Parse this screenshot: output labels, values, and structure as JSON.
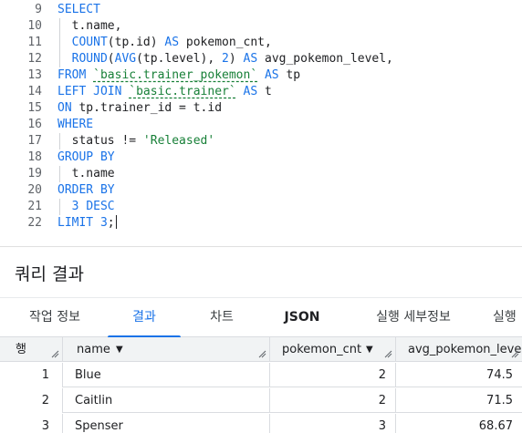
{
  "editor": {
    "lines": [
      {
        "n": "9",
        "tokens": [
          {
            "t": "SELECT",
            "c": "kw"
          }
        ]
      },
      {
        "n": "10",
        "tokens": [
          {
            "t": "  t.name,",
            "c": "plain"
          }
        ]
      },
      {
        "n": "11",
        "tokens": [
          {
            "t": "  ",
            "c": "plain"
          },
          {
            "t": "COUNT",
            "c": "fn"
          },
          {
            "t": "(tp.id) ",
            "c": "plain"
          },
          {
            "t": "AS",
            "c": "kw"
          },
          {
            "t": " pokemon_cnt,",
            "c": "plain"
          }
        ]
      },
      {
        "n": "12",
        "tokens": [
          {
            "t": "  ",
            "c": "plain"
          },
          {
            "t": "ROUND",
            "c": "fn"
          },
          {
            "t": "(",
            "c": "plain"
          },
          {
            "t": "AVG",
            "c": "fn"
          },
          {
            "t": "(tp.level), ",
            "c": "plain"
          },
          {
            "t": "2",
            "c": "num"
          },
          {
            "t": ") ",
            "c": "plain"
          },
          {
            "t": "AS",
            "c": "kw"
          },
          {
            "t": " avg_pokemon_level,",
            "c": "plain"
          }
        ]
      },
      {
        "n": "13",
        "tokens": [
          {
            "t": "FROM",
            "c": "kw"
          },
          {
            "t": " ",
            "c": "plain"
          },
          {
            "t": "`basic.trainer_pokemon`",
            "c": "tbl"
          },
          {
            "t": " ",
            "c": "plain"
          },
          {
            "t": "AS",
            "c": "kw"
          },
          {
            "t": " tp",
            "c": "plain"
          }
        ]
      },
      {
        "n": "14",
        "tokens": [
          {
            "t": "LEFT JOIN",
            "c": "kw"
          },
          {
            "t": " ",
            "c": "plain"
          },
          {
            "t": "`basic.trainer`",
            "c": "tbl"
          },
          {
            "t": " ",
            "c": "plain"
          },
          {
            "t": "AS",
            "c": "kw"
          },
          {
            "t": " t",
            "c": "plain"
          }
        ]
      },
      {
        "n": "15",
        "tokens": [
          {
            "t": "ON",
            "c": "kw"
          },
          {
            "t": " tp.trainer_id = t.id",
            "c": "plain"
          }
        ]
      },
      {
        "n": "16",
        "tokens": [
          {
            "t": "WHERE",
            "c": "kw"
          }
        ]
      },
      {
        "n": "17",
        "tokens": [
          {
            "t": "  status != ",
            "c": "plain"
          },
          {
            "t": "'Released'",
            "c": "str"
          }
        ]
      },
      {
        "n": "18",
        "tokens": [
          {
            "t": "GROUP BY",
            "c": "kw"
          }
        ]
      },
      {
        "n": "19",
        "tokens": [
          {
            "t": "  t.name",
            "c": "plain"
          }
        ]
      },
      {
        "n": "20",
        "tokens": [
          {
            "t": "ORDER BY",
            "c": "kw"
          }
        ]
      },
      {
        "n": "21",
        "tokens": [
          {
            "t": "  ",
            "c": "plain"
          },
          {
            "t": "3",
            "c": "num"
          },
          {
            "t": " ",
            "c": "plain"
          },
          {
            "t": "DESC",
            "c": "kw"
          }
        ]
      },
      {
        "n": "22",
        "tokens": [
          {
            "t": "LIMIT",
            "c": "kw"
          },
          {
            "t": " ",
            "c": "plain"
          },
          {
            "t": "3",
            "c": "num"
          },
          {
            "t": ";",
            "c": "plain"
          }
        ]
      }
    ]
  },
  "results": {
    "title": "쿼리 결과",
    "tabs": [
      {
        "label": "작업 정보",
        "name": "tab-job-info"
      },
      {
        "label": "결과",
        "name": "tab-results",
        "active": true
      },
      {
        "label": "차트",
        "name": "tab-chart"
      },
      {
        "label": "JSON",
        "name": "tab-json",
        "bold": true
      },
      {
        "label": "실행 세부정보",
        "name": "tab-execution-details"
      },
      {
        "label": "실행",
        "name": "tab-execution-graph"
      }
    ],
    "columns": {
      "row": "행",
      "name": "name",
      "pokemon_cnt": "pokemon_cnt",
      "avg_pokemon_level": "avg_pokemon_level"
    },
    "rows": [
      {
        "row": "1",
        "name": "Blue",
        "pokemon_cnt": "2",
        "avg_pokemon_level": "74.5"
      },
      {
        "row": "2",
        "name": "Caitlin",
        "pokemon_cnt": "2",
        "avg_pokemon_level": "71.5"
      },
      {
        "row": "3",
        "name": "Spenser",
        "pokemon_cnt": "3",
        "avg_pokemon_level": "68.67"
      }
    ]
  }
}
